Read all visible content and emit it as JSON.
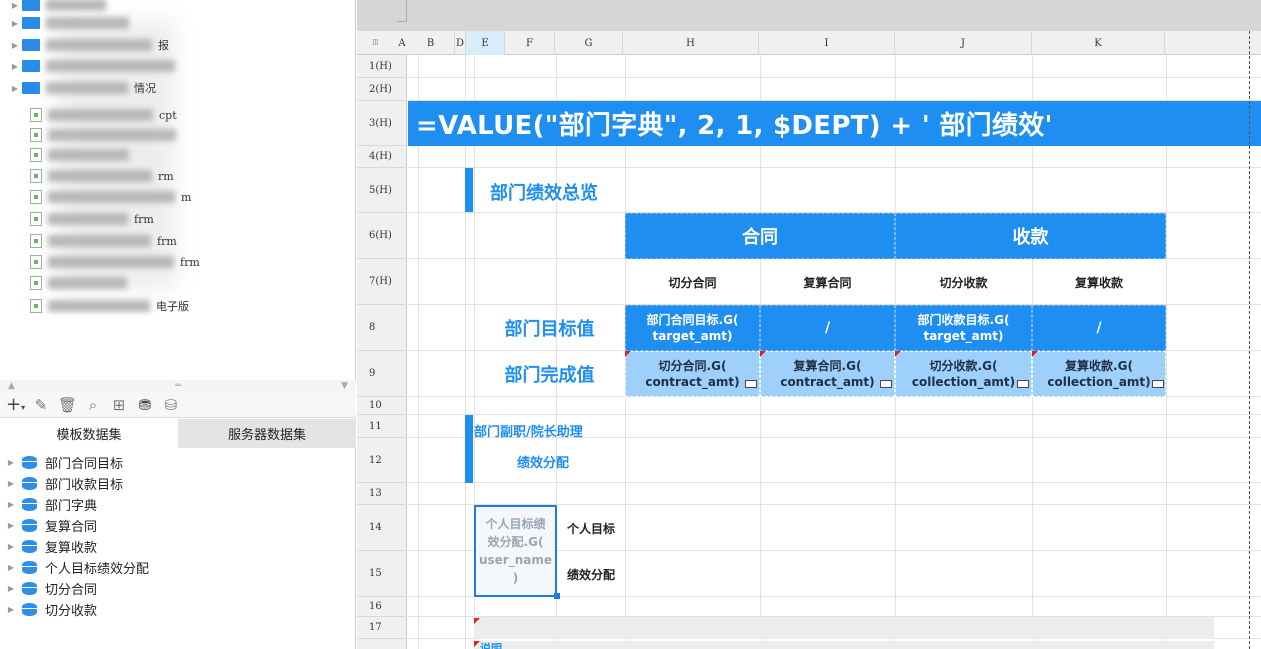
{
  "file_tree": {
    "rows": [
      {
        "kind": "folder",
        "text": ""
      },
      {
        "kind": "folder",
        "text": ""
      },
      {
        "kind": "folder",
        "text": "报"
      },
      {
        "kind": "folder",
        "text": ""
      },
      {
        "kind": "folder",
        "text": "情况"
      },
      {
        "kind": "file",
        "text": "cpt"
      },
      {
        "kind": "file",
        "text": ""
      },
      {
        "kind": "file",
        "text": ""
      },
      {
        "kind": "file",
        "text": "rm"
      },
      {
        "kind": "file",
        "text": "m"
      },
      {
        "kind": "file",
        "text": "frm"
      },
      {
        "kind": "file",
        "text": "frm"
      },
      {
        "kind": "file",
        "text": "frm"
      },
      {
        "kind": "file",
        "text": ""
      },
      {
        "kind": "file",
        "text": "电子版"
      }
    ]
  },
  "datasets": {
    "tabs": [
      "模板数据集",
      "服务器数据集"
    ],
    "items": [
      "部门合同目标",
      "部门收款目标",
      "部门字典",
      "复算合同",
      "复算收款",
      "个人目标绩效分配",
      "切分合同",
      "切分收款"
    ]
  },
  "sheet": {
    "columns": [
      "A",
      "B",
      "D",
      "E",
      "F",
      "G",
      "H",
      "I",
      "J",
      "K"
    ],
    "rows": [
      "1(H)",
      "2(H)",
      "3(H)",
      "4(H)",
      "5(H)",
      "6(H)",
      "7(H)",
      "8",
      "9",
      "10",
      "11",
      "12",
      "13",
      "14",
      "15",
      "16",
      "17"
    ],
    "formula": "=VALUE(\"部门字典\", 2, 1, $DEPT) + ' 部门绩效'",
    "section_title": "部门绩效总览",
    "group_contract": "合同",
    "group_collection": "收款",
    "sub_headers": [
      "切分合同",
      "复算合同",
      "切分收款",
      "复算收款"
    ],
    "row_target_label": "部门目标值",
    "row_done_label": "部门完成值",
    "target_cells": [
      "部门合同目标.G(\ntarget_amt)",
      "/",
      "部门收款目标.G(\ntarget_amt)",
      "/"
    ],
    "done_cells": [
      "切分合同.G(\ncontract_amt)",
      "复算合同.G(\ncontract_amt)",
      "切分收款.G(\ncollection_amt)",
      "复算收款.G(\ncollection_amt)"
    ],
    "sub_section_title": "部门副职/院长助理",
    "sub_section_subtitle": "绩效分配",
    "selected_cell": "个人目标绩\n效分配.G(\nuser_name\n)",
    "personal_target": "个人目标",
    "performance_allocation": "绩效分配",
    "bottom_label": "说明"
  },
  "colors": {
    "accent": "#1f8ef1",
    "light": "#9fd0fb"
  }
}
